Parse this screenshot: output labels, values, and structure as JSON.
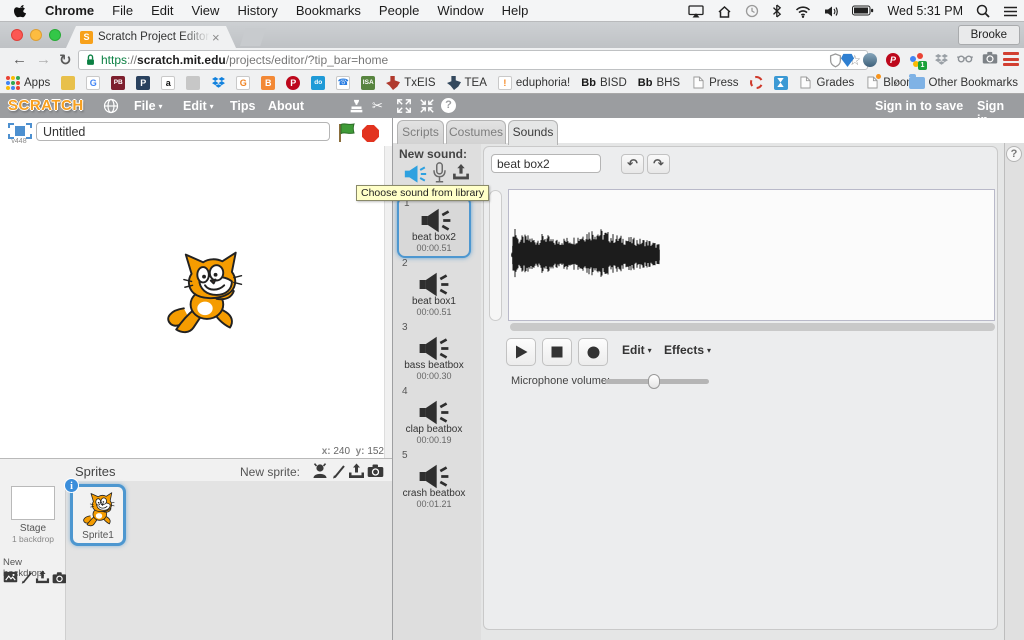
{
  "icons": {
    "caret": "▾",
    "close": "×",
    "undo": "↶",
    "redo": "↷",
    "scissors": "✂",
    "help": "?",
    "star": "☆"
  },
  "menubar": {
    "menus": [
      {
        "label": "Chrome",
        "bold": true
      },
      {
        "label": "File"
      },
      {
        "label": "Edit"
      },
      {
        "label": "View"
      },
      {
        "label": "History"
      },
      {
        "label": "Bookmarks"
      },
      {
        "label": "People"
      },
      {
        "label": "Window"
      },
      {
        "label": "Help"
      }
    ],
    "clock": "Wed 5:31 PM"
  },
  "chrome": {
    "tab": {
      "title": "Scratch Project Editor - Ima",
      "favicon_letter": "S"
    },
    "profile": "Brooke",
    "nav": {
      "back": "←",
      "forward": "→",
      "reload": "↻"
    },
    "address": {
      "scheme": "https",
      "sep": "://",
      "host": "scratch.mit.edu",
      "path": "/projects/editor/?tip_bar=home"
    },
    "bookmarks": {
      "apps": "Apps",
      "overflow": "»",
      "other": "Other Bookmarks",
      "items": [
        {
          "name": "bookmark-yellow",
          "fav": {
            "t": "sq",
            "bg": "#e8c04b"
          }
        },
        {
          "name": "bookmark-google",
          "fav": {
            "t": "letter",
            "bg": "#ffffff",
            "fg": "#4285f4",
            "g": "G",
            "border": true
          }
        },
        {
          "name": "bookmark-pb",
          "fav": {
            "t": "letter",
            "bg": "#7d1f2e",
            "fg": "#ffffff",
            "g": "PB",
            "small": true
          }
        },
        {
          "name": "bookmark-p",
          "fav": {
            "t": "letter",
            "bg": "#29415e",
            "fg": "#ffffff",
            "g": "P"
          }
        },
        {
          "name": "bookmark-amazon",
          "fav": {
            "t": "letter",
            "bg": "#ffffff",
            "fg": "#111111",
            "g": "a",
            "border": true
          }
        },
        {
          "name": "bookmark-qr",
          "fav": {
            "t": "sq",
            "bg": "#c7c7c7"
          }
        },
        {
          "name": "bookmark-dropbox",
          "fav": {
            "t": "dbx",
            "c": "#1081de"
          }
        },
        {
          "name": "bookmark-g-orange",
          "fav": {
            "t": "letter",
            "bg": "#ffffff",
            "fg": "#ef8324",
            "g": "G",
            "border": true
          }
        },
        {
          "name": "bookmark-blogger",
          "fav": {
            "t": "letter",
            "bg": "#f38936",
            "fg": "#ffffff",
            "g": "B"
          }
        },
        {
          "name": "bookmark-pinterest",
          "fav": {
            "t": "letter",
            "bg": "#bd081c",
            "fg": "#ffffff",
            "g": "P",
            "round": true
          }
        },
        {
          "name": "bookmark-do",
          "fav": {
            "t": "letter",
            "bg": "#1f9ad7",
            "fg": "#ffffff",
            "g": "do",
            "small": true
          }
        },
        {
          "name": "bookmark-phone",
          "fav": {
            "t": "letter",
            "bg": "#ffffff",
            "fg": "#2a7de1",
            "g": "☎",
            "border": true
          }
        },
        {
          "name": "bookmark-isa",
          "fav": {
            "t": "letter",
            "bg": "#57843f",
            "fg": "#ffffff",
            "g": "ISA",
            "small": true
          }
        },
        {
          "label": "TxEIS",
          "name": "bookmark-txeis",
          "fav": {
            "t": "texas",
            "c": "#b03a2e"
          }
        },
        {
          "label": "TEA",
          "name": "bookmark-tea",
          "fav": {
            "t": "texas",
            "c": "#34495e"
          }
        },
        {
          "label": "eduphoria!",
          "name": "bookmark-eduphoria",
          "fav": {
            "t": "letter",
            "bg": "#ffffff",
            "fg": "#f6871f",
            "g": "!",
            "border": true
          }
        },
        {
          "label": "BISD",
          "name": "bookmark-bisd",
          "fav": {
            "t": "bb"
          }
        },
        {
          "label": "BHS",
          "name": "bookmark-bhs",
          "fav": {
            "t": "bb"
          }
        },
        {
          "label": "Press",
          "name": "bookmark-press",
          "fav": {
            "t": "page"
          }
        },
        {
          "name": "bookmark-circle",
          "fav": {
            "t": "dashed"
          }
        },
        {
          "name": "bookmark-hourglass",
          "fav": {
            "t": "hourglass",
            "bg": "#3b99d4"
          }
        },
        {
          "label": "Grades",
          "name": "bookmark-grades",
          "fav": {
            "t": "page"
          }
        },
        {
          "label": "Bloom",
          "name": "bookmark-bloom",
          "fav": {
            "t": "page",
            "dot": true
          }
        }
      ]
    },
    "extensions": [
      {
        "name": "visor-extension-icon",
        "t": "pin",
        "bg": "#2e7fd1"
      },
      {
        "name": "screenshot-extension-icon",
        "t": "circle"
      },
      {
        "name": "pinterest-extension-icon",
        "t": "letter",
        "bg": "#bd081c",
        "fg": "#ffffff",
        "g": "P",
        "round": true
      },
      {
        "name": "google-extension-icon",
        "t": "gdots",
        "badge": "1"
      },
      {
        "name": "dropbox-extension-icon",
        "t": "dbx",
        "c": "#9aa0a6"
      },
      {
        "name": "glasses-extension-icon",
        "t": "glasses",
        "c": "#8d9297"
      },
      {
        "name": "camera-extension-icon",
        "t": "cam",
        "c": "#7d8287"
      }
    ]
  },
  "scratch": {
    "logo": "SCRATCH",
    "menu": {
      "file": "File",
      "edit": "Edit",
      "tips": "Tips",
      "about": "About"
    },
    "signin_save": "Sign in to save",
    "signin": "Sign in",
    "stage": {
      "version": "v448",
      "project_name": "Untitled",
      "x_label": "x:",
      "x_value": "240",
      "y_label": "y:",
      "y_value": "152"
    },
    "sprites": {
      "title": "Sprites",
      "new_sprite": "New sprite:",
      "stage_name": "Stage",
      "stage_info": "1 backdrop",
      "new_backdrop": "New backdrop:",
      "sprite1": "Sprite1",
      "info_badge": "i"
    },
    "tabs": {
      "scripts": "Scripts",
      "costumes": "Costumes",
      "sounds": "Sounds"
    },
    "sounds_panel": {
      "new_sound": "New sound:",
      "tooltip": "Choose sound from library",
      "items": [
        {
          "num": "1",
          "name": "beat box2",
          "duration": "00:00.51",
          "selected": true
        },
        {
          "num": "2",
          "name": "beat box1",
          "duration": "00:00.51",
          "selected": false
        },
        {
          "num": "3",
          "name": "bass beatbox",
          "duration": "00:00.30",
          "selected": false
        },
        {
          "num": "4",
          "name": "clap beatbox",
          "duration": "00:00.19",
          "selected": false
        },
        {
          "num": "5",
          "name": "crash beatbox",
          "duration": "00:01.21",
          "selected": false
        }
      ]
    },
    "editor": {
      "sound_name": "beat box2",
      "edit_menu": "Edit",
      "effects_menu": "Effects",
      "mic_label": "Microphone volume:",
      "mic_value_pct": 47,
      "waveform_envelope": [
        [
          0,
          0.08
        ],
        [
          0.015,
          1.0
        ],
        [
          0.04,
          0.5
        ],
        [
          0.1,
          0.55
        ],
        [
          0.16,
          0.45
        ],
        [
          0.22,
          0.6
        ],
        [
          0.28,
          0.42
        ],
        [
          0.34,
          0.46
        ],
        [
          0.42,
          0.5
        ],
        [
          0.5,
          0.68
        ],
        [
          0.56,
          0.75
        ],
        [
          0.62,
          0.7
        ],
        [
          0.68,
          0.58
        ],
        [
          0.74,
          0.52
        ],
        [
          0.8,
          0.48
        ],
        [
          0.86,
          0.44
        ],
        [
          0.92,
          0.42
        ],
        [
          1,
          0.28
        ]
      ]
    },
    "colors": {
      "selection_blue": "#4d97d0",
      "speaker_blue": "#2ea1e0",
      "flag_green": "#3f9b37",
      "stop_red": "#e2331f",
      "header_gray": "#9b9da0",
      "logo_orange": "#f8a01e",
      "tooltip_bg": "#ffffc8"
    }
  }
}
